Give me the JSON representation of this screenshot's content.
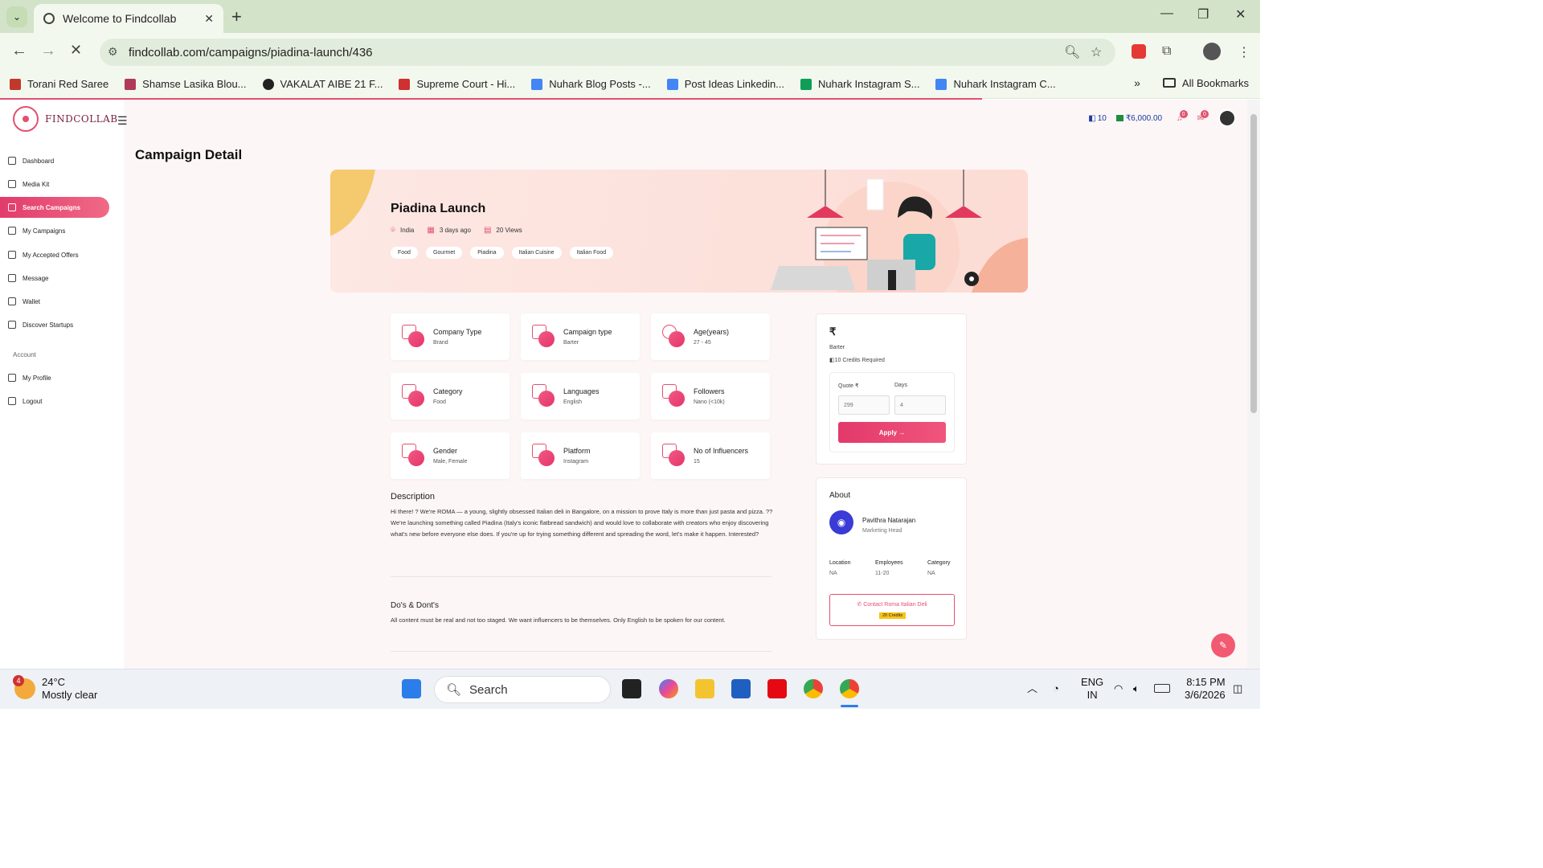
{
  "browser": {
    "tab_title": "Welcome to Findcollab",
    "url": "findcollab.com/campaigns/piadina-launch/436",
    "bookmarks": [
      {
        "label": "Torani Red Saree",
        "color": "#c0392b"
      },
      {
        "label": "Shamse Lasika Blou...",
        "color": "#b03a5a"
      },
      {
        "label": "VAKALAT AIBE 21 F...",
        "color": "#222222"
      },
      {
        "label": "Supreme Court - Hi...",
        "color": "#d0302f"
      },
      {
        "label": "Nuhark Blog Posts -...",
        "color": "#4285f4"
      },
      {
        "label": "Post Ideas Linkedin...",
        "color": "#4285f4"
      },
      {
        "label": "Nuhark Instagram S...",
        "color": "#0f9d58"
      },
      {
        "label": "Nuhark Instagram C...",
        "color": "#4285f4"
      }
    ],
    "all_bookmarks": "All Bookmarks"
  },
  "app": {
    "brand": "FINDCOLLAB",
    "header": {
      "credits": "10",
      "balance": "₹6,000.00",
      "notif_count": "0",
      "msg_count": "0"
    },
    "sidebar": {
      "items": [
        {
          "label": "Dashboard"
        },
        {
          "label": "Media Kit"
        },
        {
          "label": "Search Campaigns"
        },
        {
          "label": "My Campaigns"
        },
        {
          "label": "My Accepted Offers"
        },
        {
          "label": "Message"
        },
        {
          "label": "Wallet"
        },
        {
          "label": "Discover Startups"
        }
      ],
      "account_label": "Account",
      "account_items": [
        {
          "label": "My Profile"
        },
        {
          "label": "Logout"
        }
      ]
    },
    "page_title": "Campaign Detail",
    "campaign": {
      "title": "Piadina Launch",
      "location": "India",
      "posted": "3 days ago",
      "views": "20 Views",
      "tags": [
        "Food",
        "Gourmet",
        "Piadina",
        "Italian Cuisine",
        "Italian Food"
      ]
    },
    "info_cards": [
      {
        "label": "Company Type",
        "value": "Brand"
      },
      {
        "label": "Campaign type",
        "value": "Barter"
      },
      {
        "label": "Age(years)",
        "value": "27 - 45"
      },
      {
        "label": "Category",
        "value": "Food"
      },
      {
        "label": "Languages",
        "value": "English"
      },
      {
        "label": "Followers",
        "value": "Nano (<10k)"
      },
      {
        "label": "Gender",
        "value": "Male, Female"
      },
      {
        "label": "Platform",
        "value": "Instagram"
      },
      {
        "label": "No of Influencers",
        "value": "15"
      }
    ],
    "description": {
      "heading": "Description",
      "text": "Hi there! ? We're ROMA — a young, slightly obsessed Italian deli in Bangalore, on a mission to prove Italy is more than just pasta and pizza. ?? We're launching something called Piadina (Italy's iconic flatbread sandwich) and would love to collaborate with creators who enjoy discovering what's new before everyone else does. If you're up for trying something different and spreading the word, let's make it happen. Interested?"
    },
    "dos_donts": {
      "heading": "Do's & Dont's",
      "text": "All content must be real and not too staged. We want influencers to be themselves. Only English to be spoken for our content."
    },
    "apply": {
      "currency_symbol": "₹",
      "type": "Barter",
      "credits_required": "10 Credits Required",
      "quote_label": "Quote ₹",
      "quote_placeholder": "299",
      "days_label": "Days",
      "days_placeholder": "4",
      "apply_label": "Apply →"
    },
    "about": {
      "heading": "About",
      "name": "Pavithra Natarajan",
      "role": "Marketing Head",
      "location_label": "Location",
      "location_value": "NA",
      "employees_label": "Employees",
      "employees_value": "11-20",
      "category_label": "Category",
      "category_value": "NA",
      "contact_label": "Contact Roma Italian Deli",
      "contact_credits": "20 Credits"
    }
  },
  "taskbar": {
    "temperature": "24°C",
    "weather": "Mostly clear",
    "weather_badge": "4",
    "search_label": "Search",
    "lang": "ENG",
    "region": "IN",
    "time": "8:15 PM",
    "date": "3/6/2026"
  }
}
